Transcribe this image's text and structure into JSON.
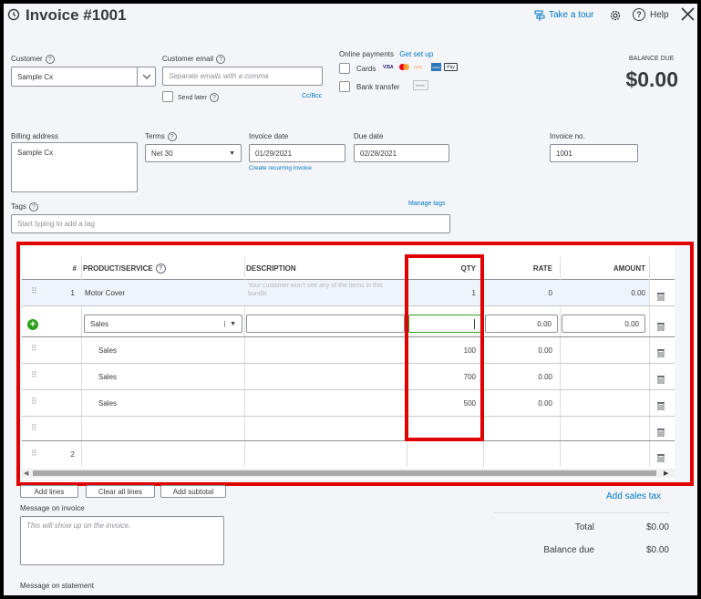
{
  "header": {
    "title": "Invoice #1001",
    "take_tour": "Take a tour",
    "help": "Help"
  },
  "customer": {
    "label": "Customer",
    "value": "Sample Cx"
  },
  "customer_email": {
    "label": "Customer email",
    "placeholder": "Separate emails with a comma",
    "send_later": "Send later",
    "cc_bcc": "Cc/Bcc"
  },
  "online_payments": {
    "label": "Online payments",
    "get_set_up": "Get set up",
    "cards": "Cards",
    "bank_transfer": "Bank transfer",
    "card_brands": [
      "VISA",
      "MC",
      "DISC",
      "AMEX",
      "Pay"
    ],
    "bank_badge": "BANK"
  },
  "balance": {
    "label": "BALANCE DUE",
    "value": "$0.00"
  },
  "billing_address": {
    "label": "Billing address",
    "value": "Sample Cx"
  },
  "terms": {
    "label": "Terms",
    "value": "Net 30"
  },
  "invoice_date": {
    "label": "Invoice date",
    "value": "01/29/2021",
    "recurring_link": "Create recurring invoice"
  },
  "due_date": {
    "label": "Due date",
    "value": "02/28/2021"
  },
  "invoice_no": {
    "label": "Invoice no.",
    "value": "1001"
  },
  "tags": {
    "label": "Tags",
    "manage": "Manage tags",
    "placeholder": "Start typing to add a tag"
  },
  "table": {
    "columns": {
      "num": "#",
      "product": "PRODUCT/SERVICE",
      "description": "DESCRIPTION",
      "qty": "QTY",
      "rate": "RATE",
      "amount": "AMOUNT"
    },
    "row1": {
      "num": "1",
      "product": "Motor Cover",
      "description_placeholder": "Your customer won't see any of the items in this bundle",
      "qty": "1",
      "rate": "0",
      "amount": "0.00"
    },
    "edit_row": {
      "product": "Sales",
      "rate": "0.00",
      "amount": "0.00"
    },
    "sub_rows": [
      {
        "product": "Sales",
        "qty": "100",
        "rate": "0.00"
      },
      {
        "product": "Sales",
        "qty": "700",
        "rate": "0.00"
      },
      {
        "product": "Sales",
        "qty": "500",
        "rate": "0.00"
      }
    ],
    "row2": {
      "num": "2"
    }
  },
  "actions": {
    "add_lines": "Add lines",
    "clear_all_lines": "Clear all lines",
    "add_subtotal": "Add subtotal",
    "add_sales_tax": "Add sales tax"
  },
  "message_invoice": {
    "label": "Message on invoice",
    "placeholder": "This will show up on the invoice."
  },
  "message_statement": {
    "label": "Message on statement"
  },
  "totals": {
    "total_label": "Total",
    "total_value": "$0.00",
    "balance_due_label": "Balance due",
    "balance_due_value": "$0.00"
  },
  "colors": {
    "accent": "#0077c5",
    "highlight": "#e00000",
    "add_green": "#2ca01c"
  }
}
